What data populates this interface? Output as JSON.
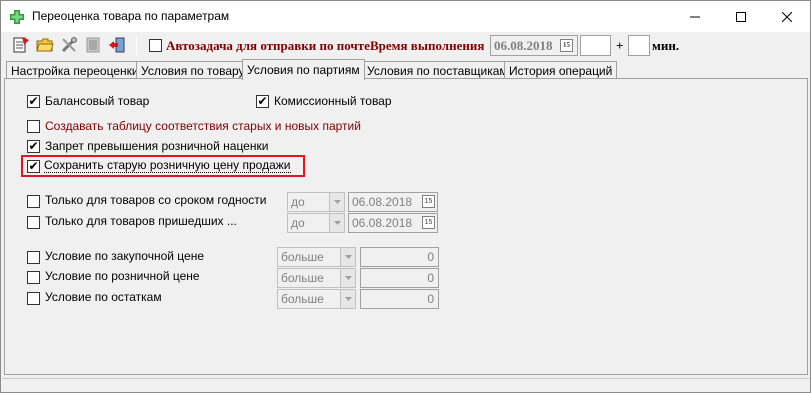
{
  "window": {
    "title": "Переоценка товара по параметрам",
    "minimize_glyph": "—",
    "maximize_glyph": "☐",
    "close_glyph": "✕"
  },
  "toolbar": {
    "autotask_label": "Автозадача для отправки по почте",
    "autotask_checked": false,
    "time_label": "Время выполнения",
    "date_value": "06.08.2018",
    "calendar_glyph": "15",
    "hours_value": "",
    "plus_label": "+",
    "minutes_value": "",
    "min_label": "мин.",
    "icons": [
      "new-document-icon",
      "open-folder-icon",
      "tools-icon",
      "disabled-doc-icon",
      "exit-door-icon"
    ]
  },
  "tabs": [
    {
      "label": "Настройка переоценки",
      "active": false
    },
    {
      "label": "Условия по товару",
      "active": false
    },
    {
      "label": "Условия по партиям",
      "active": true
    },
    {
      "label": "Условия по поставщикам",
      "active": false
    },
    {
      "label": "История операций",
      "active": false
    }
  ],
  "panel": {
    "balance_goods": {
      "label": "Балансовый товар",
      "checked": true
    },
    "commission_goods": {
      "label": "Комиссионный товар",
      "checked": true
    },
    "create_table": {
      "label": "Создавать таблицу соответствия старых и новых партий",
      "checked": false
    },
    "forbid_markup": {
      "label": "Запрет превышения розничной наценки",
      "checked": true
    },
    "keep_old_price": {
      "label": "Сохранить старую розничную цену продажи",
      "checked": true
    },
    "expiry_only": {
      "label": "Только для товаров со сроком годности",
      "checked": false,
      "op": "до",
      "date": "06.08.2018"
    },
    "arrived_only": {
      "label": "Только для товаров пришедших ...",
      "checked": false,
      "op": "до",
      "date": "06.08.2018"
    },
    "purchase_cond": {
      "label": "Условие по закупочной цене",
      "checked": false,
      "op": "больше",
      "value": "0"
    },
    "retail_cond": {
      "label": "Условие по розничной цене",
      "checked": false,
      "op": "больше",
      "value": "0"
    },
    "stock_cond": {
      "label": "Условие по остаткам",
      "checked": false,
      "op": "больше",
      "value": "0"
    },
    "check_glyph": "✔",
    "calendar_glyph": "15"
  },
  "colors": {
    "accent_red_text": "#800000",
    "highlight_border": "#e8141c"
  }
}
